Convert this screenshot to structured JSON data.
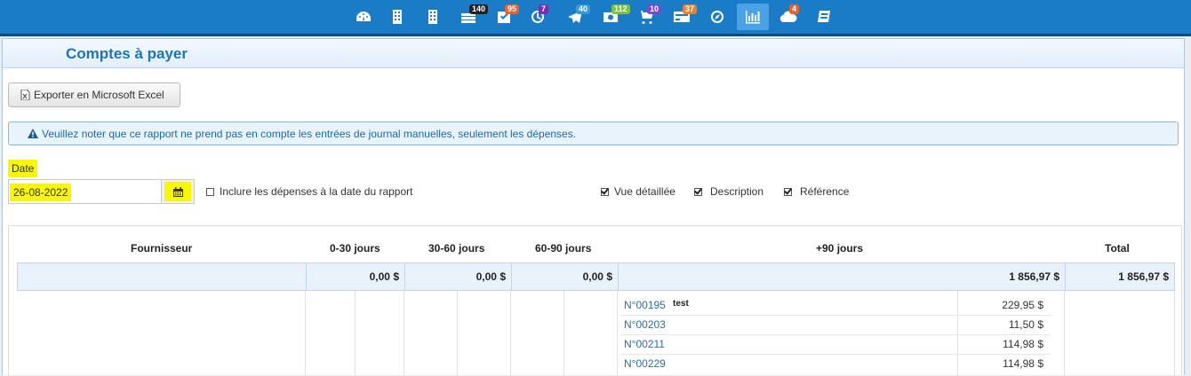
{
  "topbar": {
    "icons": [
      {
        "name": "dashboard-icon",
        "badge": null,
        "badge_color": null
      },
      {
        "name": "building-icon",
        "badge": null,
        "badge_color": null
      },
      {
        "name": "building-alt-icon",
        "badge": null,
        "badge_color": null
      },
      {
        "name": "cash-icon",
        "badge": "140",
        "badge_color": "#222222"
      },
      {
        "name": "checkbox-icon",
        "badge": "95",
        "badge_color": "#e8632b"
      },
      {
        "name": "clock-icon",
        "badge": "7",
        "badge_color": "#7b2bb6"
      },
      {
        "name": "paper-plane-icon",
        "badge": "40",
        "badge_color": "#3a9ad9"
      },
      {
        "name": "money-icon",
        "badge": "112",
        "badge_color": "#7cc141"
      },
      {
        "name": "cart-icon",
        "badge": "10",
        "badge_color": "#7b49c8"
      },
      {
        "name": "credit-card-icon",
        "badge": "37",
        "badge_color": "#e8832b"
      },
      {
        "name": "compass-icon",
        "badge": null,
        "badge_color": null
      },
      {
        "name": "bar-chart-icon",
        "badge": null,
        "badge_color": null,
        "active": true
      },
      {
        "name": "cloud-icon",
        "badge": "4",
        "badge_color": "#e8632b"
      },
      {
        "name": "book-icon",
        "badge": null,
        "badge_color": null
      }
    ]
  },
  "page": {
    "title": "Comptes à payer",
    "export_label": "Exporter en Microsoft Excel",
    "notice": "Veuillez noter que ce rapport ne prend pas en compte les entrées de journal manuelles, seulement les dépenses."
  },
  "filters": {
    "date_label": "Date",
    "date_value": "26-08-2022",
    "include_label": "Inclure les dépenses à la date du rapport",
    "include_checked": false,
    "detailed_label": "Vue détaillée",
    "description_label": "Description",
    "reference_label": "Référence"
  },
  "table": {
    "headers": {
      "supplier": "Fournisseur",
      "d0_30": "0-30 jours",
      "d30_60": "30-60 jours",
      "d60_90": "60-90 jours",
      "d90": "+90 jours",
      "total": "Total"
    },
    "totals": {
      "d0_30": "0,00 $",
      "d30_60": "0,00 $",
      "d60_90": "0,00 $",
      "d90": "1 856,97 $",
      "total": "1 856,97 $"
    },
    "invoices": [
      {
        "ref": "N°00195",
        "desc": "test",
        "amount": "229,95 $"
      },
      {
        "ref": "N°00203",
        "desc": "",
        "amount": "11,50 $"
      },
      {
        "ref": "N°00211",
        "desc": "",
        "amount": "114,98 $"
      },
      {
        "ref": "N°00229",
        "desc": "",
        "amount": "114,98 $"
      }
    ]
  }
}
